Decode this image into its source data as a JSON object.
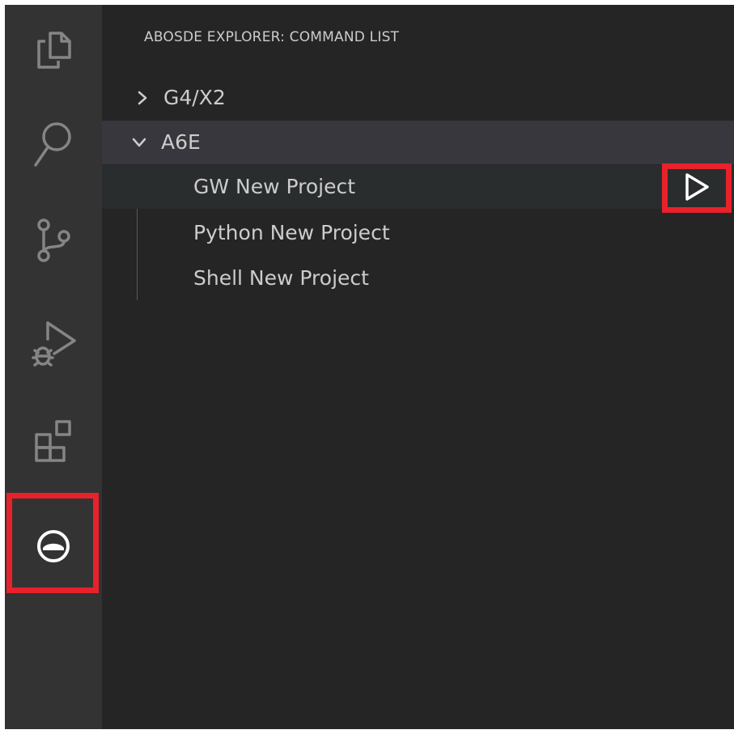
{
  "activity_bar": {
    "items": [
      {
        "name": "explorer",
        "icon": "files-icon"
      },
      {
        "name": "search",
        "icon": "search-icon"
      },
      {
        "name": "source-control",
        "icon": "source-control-icon"
      },
      {
        "name": "run-and-debug",
        "icon": "run-debug-icon"
      },
      {
        "name": "extensions",
        "icon": "extensions-icon"
      },
      {
        "name": "abosde-explorer",
        "icon": "abosde-logo-icon",
        "highlighted": true
      }
    ]
  },
  "sidebar": {
    "title": "ABOSDE EXPLORER: COMMAND LIST",
    "tree": [
      {
        "label": "G4/X2",
        "expanded": false,
        "children": []
      },
      {
        "label": "A6E",
        "expanded": true,
        "children": [
          {
            "label": "GW New Project",
            "hovered": true,
            "action_icon": "play-icon"
          },
          {
            "label": "Python New Project"
          },
          {
            "label": "Shell New Project"
          }
        ]
      }
    ]
  },
  "colors": {
    "activity_bar_bg": "#333333",
    "sidebar_bg": "#252526",
    "selected_row_bg": "#37373d",
    "hover_row_bg": "#2a2d2e",
    "icon_inactive": "#858585",
    "text": "#cccccc",
    "highlight_box": "#e8212b"
  }
}
